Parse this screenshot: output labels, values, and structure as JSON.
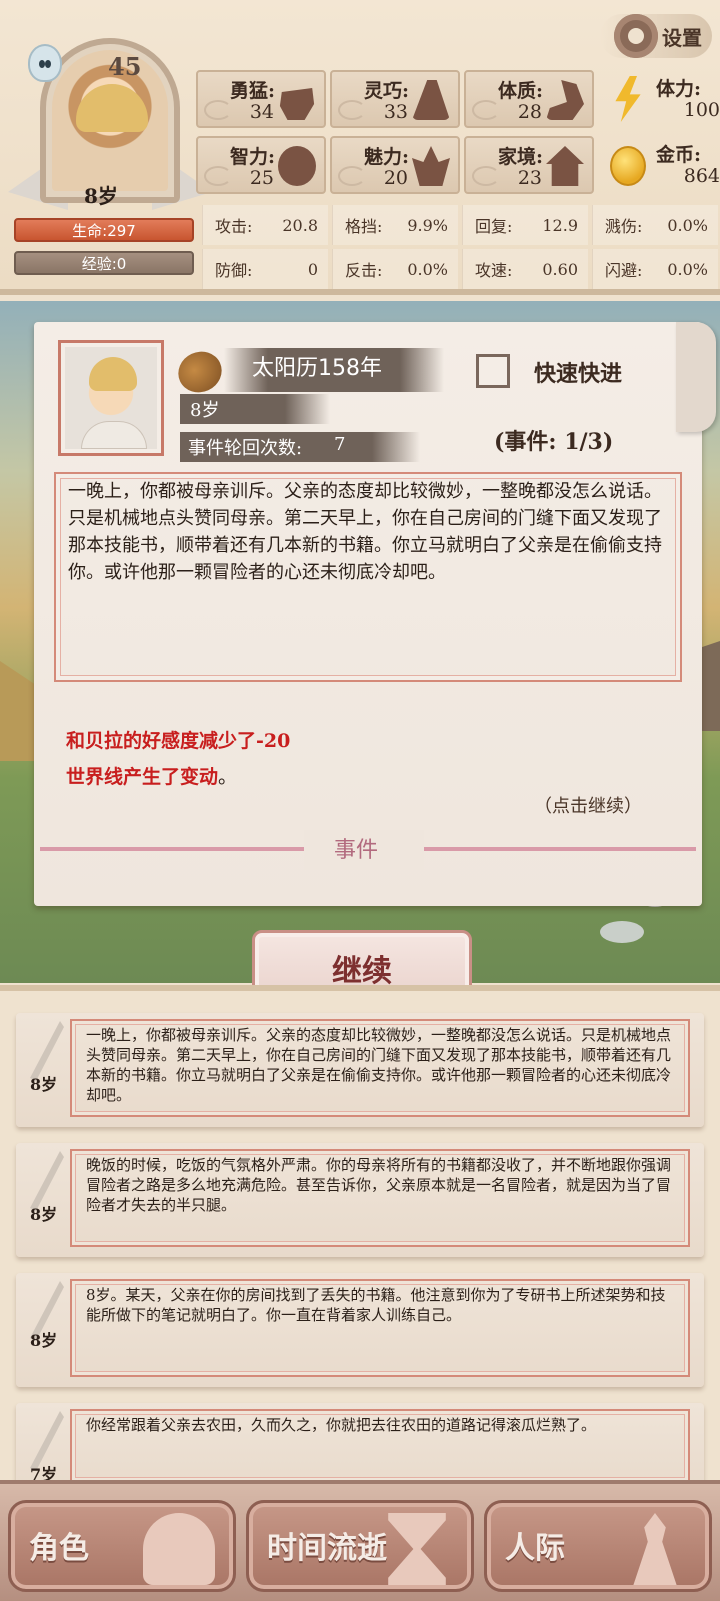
{
  "settings": {
    "label": "设置"
  },
  "player": {
    "level": "45",
    "age_overlay": "8岁",
    "hp_label": "生命:297",
    "exp_label": "经验:0"
  },
  "stats": [
    {
      "label": "勇猛:",
      "value": "34",
      "icon": "fist-icon"
    },
    {
      "label": "灵巧:",
      "value": "33",
      "icon": "cloak-icon"
    },
    {
      "label": "体质:",
      "value": "28",
      "icon": "arm-icon"
    },
    {
      "label": "智力:",
      "value": "25",
      "icon": "brain-icon"
    },
    {
      "label": "魅力:",
      "value": "20",
      "icon": "lotus-icon"
    },
    {
      "label": "家境:",
      "value": "23",
      "icon": "home-icon"
    }
  ],
  "resources": {
    "stamina": {
      "label": "体力:",
      "value": "100",
      "icon": "lightning-icon"
    },
    "gold": {
      "label": "金币:",
      "value": "864",
      "icon": "coin-icon"
    }
  },
  "attributes": [
    {
      "label": "攻击:",
      "value": "20.8"
    },
    {
      "label": "格挡:",
      "value": "9.9%"
    },
    {
      "label": "回复:",
      "value": "12.9"
    },
    {
      "label": "溅伤:",
      "value": "0.0%"
    },
    {
      "label": "防御:",
      "value": "0"
    },
    {
      "label": "反击:",
      "value": "0.0%"
    },
    {
      "label": "攻速:",
      "value": "0.60"
    },
    {
      "label": "闪避:",
      "value": "0.0%"
    }
  ],
  "event": {
    "date": "太阳历158年",
    "fast_forward_label": "快速快进",
    "age": "8岁",
    "cycle_label": "事件轮回次数:",
    "cycle_value": "7",
    "count": "(事件: 1/3)",
    "text": "一晚上，你都被母亲训斥。父亲的态度却比较微妙，一整晚都没怎么说话。只是机械地点头赞同母亲。第二天早上，你在自己房间的门缝下面又发现了那本技能书，顺带着还有几本新的书籍。你立马就明白了父亲是在偷偷支持你。或许他那一颗冒险者的心还未彻底冷却吧。",
    "effect_1": "和贝拉的好感度减少了-20",
    "effect_2": "世界线产生了变动",
    "effect_2_tail": "。",
    "click_hint": "（点击继续）",
    "footer_label": "事件"
  },
  "continue_button": "继续",
  "log": [
    {
      "age": "8岁",
      "text": "一晚上，你都被母亲训斥。父亲的态度却比较微妙，一整晚都没怎么说话。只是机械地点头赞同母亲。第二天早上，你在自己房间的门缝下面又发现了那本技能书，顺带着还有几本新的书籍。你立马就明白了父亲是在偷偷支持你。或许他那一颗冒险者的心还未彻底冷却吧。"
    },
    {
      "age": "8岁",
      "text": "晚饭的时候，吃饭的气氛格外严肃。你的母亲将所有的书籍都没收了，并不断地跟你强调冒险者之路是多么地充满危险。甚至告诉你，父亲原本就是一名冒险者，就是因为当了冒险者才失去的半只腿。"
    },
    {
      "age": "8岁",
      "text": "8岁。某天，父亲在你的房间找到了丢失的书籍。他注意到你为了专研书上所述架势和技能所做下的笔记就明白了。你一直在背着家人训练自己。"
    },
    {
      "age": "7岁",
      "text": "你经常跟着父亲去农田，久而久之，你就把去往农田的道路记得滚瓜烂熟了。"
    }
  ],
  "nav": {
    "role": "角色",
    "time": "时间流逝",
    "social": "人际"
  }
}
